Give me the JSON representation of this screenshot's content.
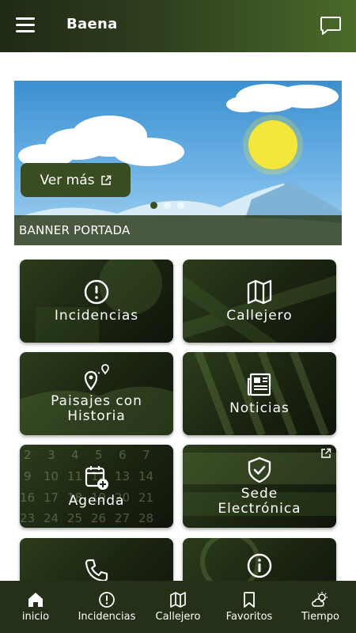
{
  "header": {
    "title": "Baena"
  },
  "banner": {
    "button_label": "Ver más",
    "caption": "BANNER PORTADA",
    "slides": 3,
    "active_slide": 1
  },
  "tiles": [
    {
      "label": "Incidencias",
      "icon": "alert-circle-icon"
    },
    {
      "label": "Callejero",
      "icon": "map-icon"
    },
    {
      "label": "Paisajes con Historia",
      "icon": "route-pin-icon"
    },
    {
      "label": "Noticias",
      "icon": "newspaper-icon"
    },
    {
      "label": "Agenda",
      "icon": "calendar-add-icon"
    },
    {
      "label": "Sede Electrónica",
      "icon": "shield-check-icon",
      "external": true
    },
    {
      "label": "",
      "icon": "phone-icon"
    },
    {
      "label": "",
      "icon": "info-icon"
    }
  ],
  "bottom_nav": [
    {
      "label": "inicio",
      "icon": "home-icon"
    },
    {
      "label": "Incidencias",
      "icon": "alert-circle-icon"
    },
    {
      "label": "Callejero",
      "icon": "map-icon"
    },
    {
      "label": "Favoritos",
      "icon": "bookmark-icon"
    },
    {
      "label": "Tiempo",
      "icon": "weather-icon"
    }
  ],
  "colors": {
    "header_dark": "#1f2a14",
    "header_light": "#4a6a2a",
    "accent": "#3a4d22",
    "nav_bg": "#243018"
  }
}
